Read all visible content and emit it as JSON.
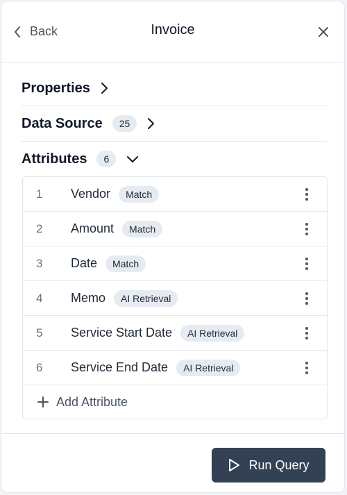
{
  "header": {
    "back_label": "Back",
    "title": "Invoice"
  },
  "sections": {
    "properties": {
      "label": "Properties"
    },
    "data_source": {
      "label": "Data Source",
      "count": "25"
    },
    "attributes": {
      "label": "Attributes",
      "count": "6"
    }
  },
  "attributes": [
    {
      "index": "1",
      "name": "Vendor",
      "tag": "Match"
    },
    {
      "index": "2",
      "name": "Amount",
      "tag": "Match"
    },
    {
      "index": "3",
      "name": "Date",
      "tag": "Match"
    },
    {
      "index": "4",
      "name": "Memo",
      "tag": "AI Retrieval"
    },
    {
      "index": "5",
      "name": "Service Start Date",
      "tag": "AI Retrieval"
    },
    {
      "index": "6",
      "name": "Service End Date",
      "tag": "AI Retrieval"
    }
  ],
  "add_attribute_label": "Add Attribute",
  "footer": {
    "run_query_label": "Run Query"
  },
  "icons": {
    "back": "chevron-left-icon",
    "close": "close-icon",
    "expand": "chevron-right-icon",
    "collapse": "chevron-down-icon",
    "row_menu": "kebab-menu-icon",
    "add": "plus-icon",
    "run": "play-icon"
  },
  "colors": {
    "primary_button": "#334155",
    "pill_background": "#e6ebf1",
    "border": "#e5e7eb"
  }
}
